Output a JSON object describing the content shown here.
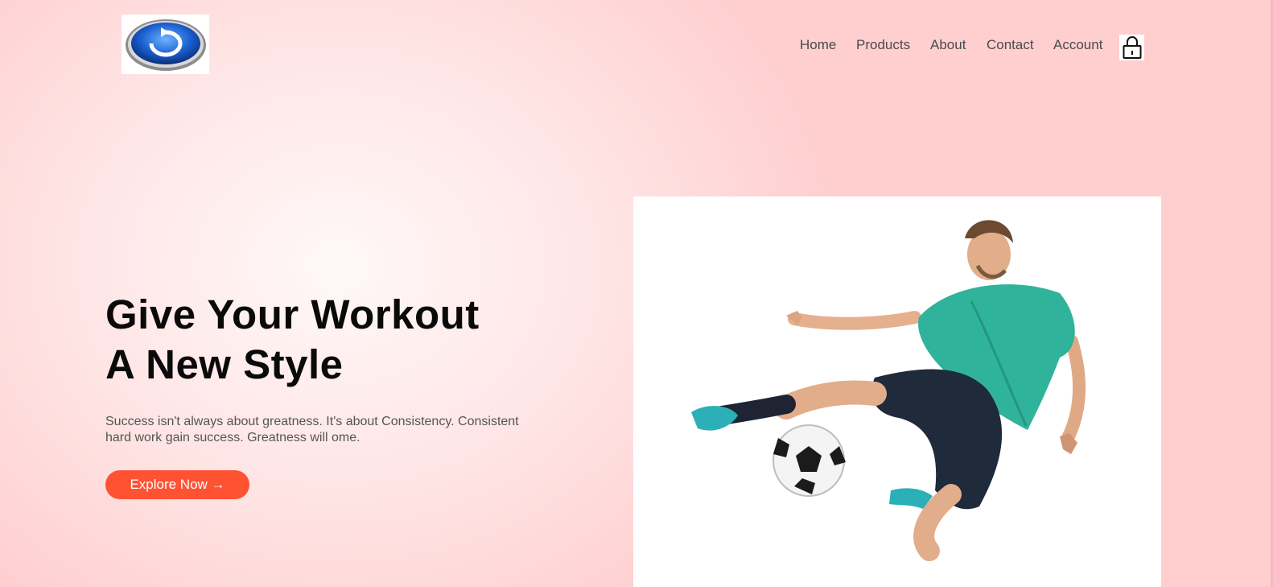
{
  "nav": {
    "links": [
      "Home",
      "Products",
      "About",
      "Contact",
      "Account"
    ]
  },
  "icons": {
    "logo": "refresh-logo-icon",
    "cart": "lock-bag-icon"
  },
  "hero": {
    "title_line1": "Give Your Workout",
    "title_line2": "A New Style",
    "subtitle": "Success isn't always about greatness. It's about Consistency. Consistent hard work gain success. Greatness will ome.",
    "cta_label": "Explore Now →"
  },
  "colors": {
    "accent": "#ff5233",
    "background": "#ffd6d6",
    "jersey": "#2fb39a",
    "shorts": "#1f2a3a"
  }
}
